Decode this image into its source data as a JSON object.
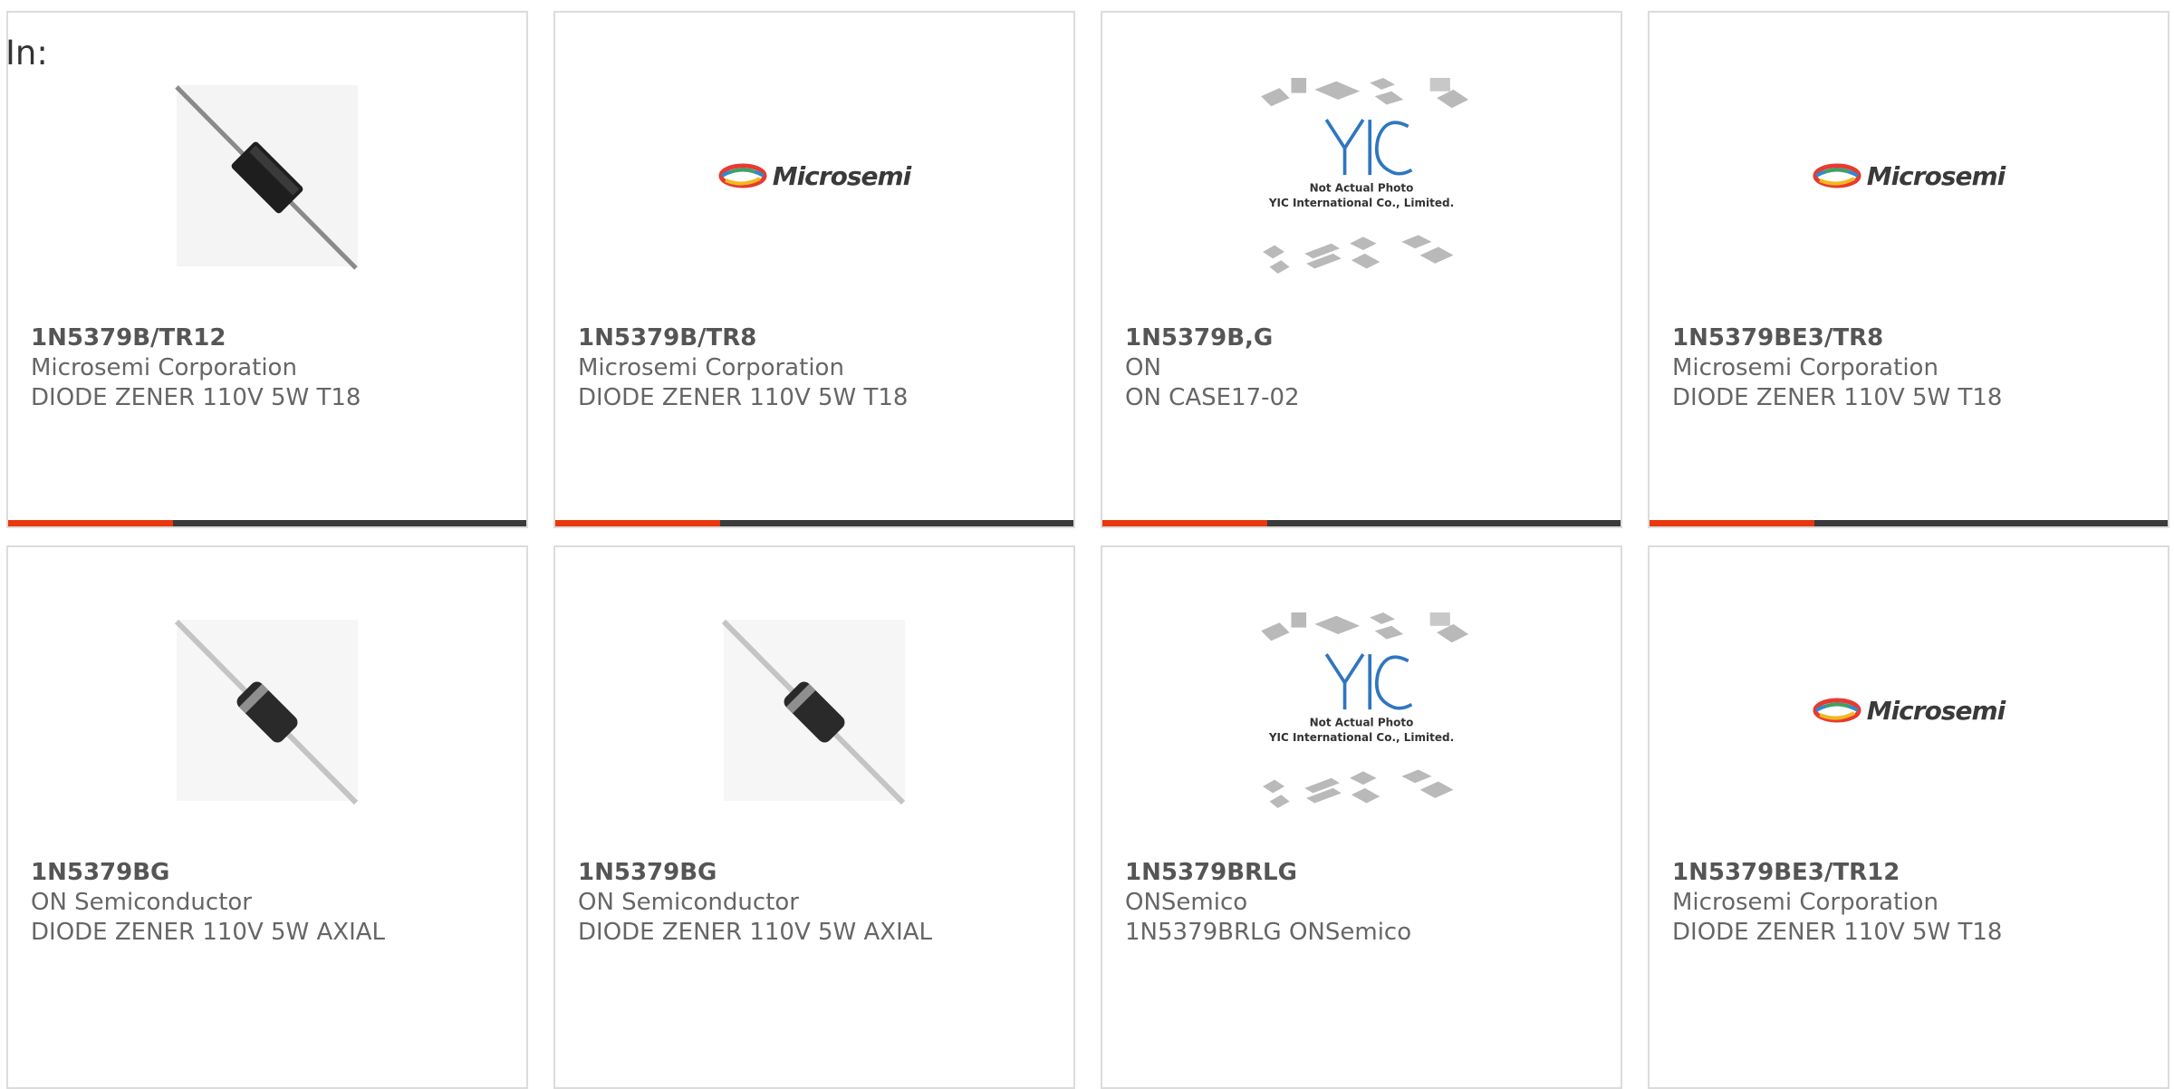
{
  "filter_label": "In:",
  "colors": {
    "accent": "#e8380d",
    "bar": "#3b3b3b",
    "border": "#dcdcdc"
  },
  "products": [
    {
      "part_no": "1N5379B/TR12",
      "manufacturer": "Microsemi Corporation",
      "description": "DIODE ZENER 110V 5W T18",
      "image": "diode-photo-icon"
    },
    {
      "part_no": "1N5379B/TR8",
      "manufacturer": "Microsemi Corporation",
      "description": "DIODE ZENER 110V 5W T18",
      "image": "microsemi-logo",
      "logo_text": "Microsemi"
    },
    {
      "part_no": "1N5379B,G",
      "manufacturer": "ON",
      "description": "ON CASE17-02",
      "image": "not-actual-photo-placeholder",
      "placeholder_line1": "Not Actual Photo",
      "placeholder_line2": "YIC International Co., Limited."
    },
    {
      "part_no": "1N5379BE3/TR8",
      "manufacturer": "Microsemi Corporation",
      "description": "DIODE ZENER 110V 5W T18",
      "image": "microsemi-logo",
      "logo_text": "Microsemi"
    },
    {
      "part_no": "1N5379BG",
      "manufacturer": "ON Semiconductor",
      "description": "DIODE ZENER 110V 5W AXIAL",
      "image": "axial-diode-photo-icon"
    },
    {
      "part_no": "1N5379BG",
      "manufacturer": "ON Semiconductor",
      "description": "DIODE ZENER 110V 5W AXIAL",
      "image": "axial-diode-photo-icon"
    },
    {
      "part_no": "1N5379BRLG",
      "manufacturer": "ONSemico",
      "description": "1N5379BRLG ONSemico",
      "image": "not-actual-photo-placeholder",
      "placeholder_line1": "Not Actual Photo",
      "placeholder_line2": "YIC International Co., Limited."
    },
    {
      "part_no": "1N5379BE3/TR12",
      "manufacturer": "Microsemi Corporation",
      "description": "DIODE ZENER 110V 5W T18",
      "image": "microsemi-logo",
      "logo_text": "Microsemi"
    }
  ]
}
